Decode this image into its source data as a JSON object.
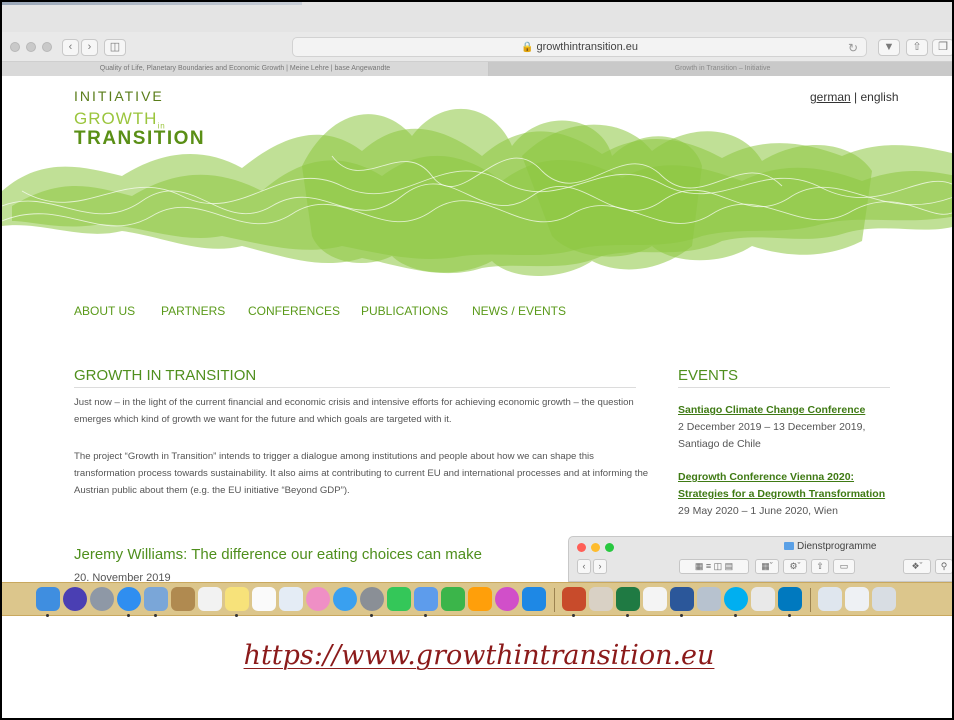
{
  "browser": {
    "url": "growthintransition.eu",
    "tabs": [
      "Quality of Life, Planetary Boundaries and Economic Growth | Meine Lehre | base Angewandte",
      "Growth in Transition – Initiative"
    ]
  },
  "site": {
    "logo": {
      "line1": "INITIATIVE",
      "line2": "GROWTH",
      "line2_sub": "in",
      "line3": "TRANSITION"
    },
    "lang": {
      "german": "german",
      "separator": " | ",
      "english": "english"
    },
    "nav": [
      "ABOUT US",
      "PARTNERS",
      "CONFERENCES",
      "PUBLICATIONS",
      "NEWS / EVENTS"
    ],
    "main": {
      "title": "GROWTH IN TRANSITION",
      "para1": "Just now – in the light of the current financial and economic crisis and intensive efforts for achieving economic growth – the question emerges which kind of growth we want for the future and which goals are targeted with it.",
      "para2": "The project “Growth in Transition” intends to trigger a dialogue among institutions and people about how we can shape this transformation process towards sustainability. It also aims at contributing to current EU and international processes and at informing the Austrian public about them (e.g. the EU initiative “Beyond GDP”)."
    },
    "news": {
      "title": "Jeremy Williams: The difference our eating choices can make",
      "date": "20. November 2019"
    },
    "events": {
      "title": "EVENTS",
      "items": [
        {
          "link": "Santiago Climate Change Conference",
          "date": "2 December 2019 – 13 December 2019,",
          "place": "Santiago de Chile"
        },
        {
          "link_line1": "Degrowth Conference Vienna 2020:",
          "link_line2": "Strategies for a Degrowth Transformation",
          "date": "29 May 2020 – 1 June 2020, Wien"
        }
      ]
    },
    "colors": {
      "accent": "#5a9a1a",
      "leaf": "#8cc63f"
    }
  },
  "finder": {
    "title": "Dienstprogramme"
  },
  "caption": "https://www.growthintransition.eu"
}
